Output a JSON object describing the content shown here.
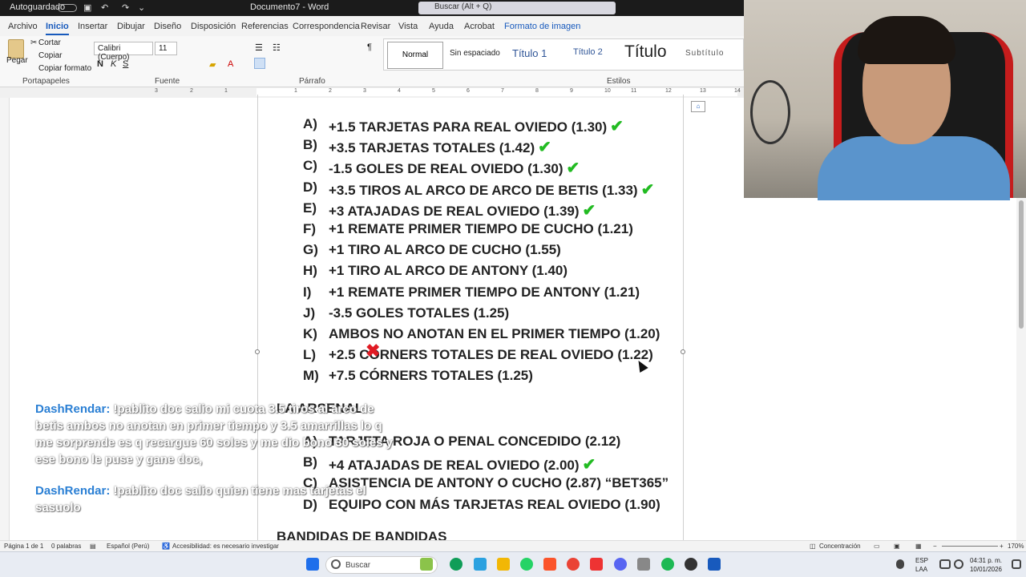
{
  "titlebar": {
    "autosave": "Autoguardado",
    "doc_title": "Documento7 - Word",
    "search": "Buscar (Alt + Q)"
  },
  "tabs": [
    "Archivo",
    "Inicio",
    "Insertar",
    "Dibujar",
    "Diseño",
    "Disposición",
    "Referencias",
    "Correspondencia",
    "Revisar",
    "Vista",
    "Ayuda",
    "Acrobat",
    "Formato de imagen"
  ],
  "ribbon": {
    "clipboard": {
      "paste": "Pegar",
      "cut": "Cortar",
      "copy": "Copiar",
      "format_painter": "Copiar formato",
      "label": "Portapapeles"
    },
    "font": {
      "name": "Calibri (Cuerpo)",
      "size": "11",
      "label": "Fuente",
      "bold": "N",
      "italic": "K",
      "underline": "S"
    },
    "paragraph": {
      "label": "Párrafo"
    },
    "styles": {
      "label": "Estilos",
      "items": [
        "Normal",
        "Sin espaciado",
        "Título 1",
        "Título 2",
        "Título",
        "Subtítulo"
      ]
    }
  },
  "ruler_numbers": [
    "3",
    "2",
    "1",
    "1",
    "2",
    "3",
    "4",
    "5",
    "6",
    "7",
    "8",
    "9",
    "10",
    "11",
    "12",
    "13",
    "14"
  ],
  "picks": [
    {
      "letter": "A)",
      "text": "+1.5 TARJETAS PARA REAL OVIEDO (1.30)",
      "check": true
    },
    {
      "letter": "B)",
      "text": "+3.5 TARJETAS TOTALES (1.42)",
      "check": true
    },
    {
      "letter": "C)",
      "text": "-1.5 GOLES DE REAL OVIEDO (1.30)",
      "check": true
    },
    {
      "letter": "D)",
      "text": "+3.5 TIROS AL ARCO DE ARCO DE BETIS (1.33)",
      "check": true
    },
    {
      "letter": "E)",
      "text": "+3 ATAJADAS DE REAL OVIEDO (1.39)",
      "check": true
    },
    {
      "letter": "F)",
      "text": "+1 REMATE PRIMER TIEMPO DE CUCHO (1.21)",
      "check": false
    },
    {
      "letter": "G)",
      "text": "+1 TIRO AL ARCO DE CUCHO (1.55)",
      "check": false
    },
    {
      "letter": "H)",
      "text": "+1 TIRO AL ARCO DE ANTONY (1.40)",
      "check": false
    },
    {
      "letter": "I)",
      "text": "+1 REMATE PRIMER TIEMPO DE ANTONY (1.21)",
      "check": false
    },
    {
      "letter": "J)",
      "text": "-3.5 GOLES TOTALES (1.25)",
      "check": false
    },
    {
      "letter": "K)",
      "text": "AMBOS NO ANOTAN EN EL PRIMER TIEMPO (1.20)",
      "check": false
    },
    {
      "letter": "L)",
      "text": "+2.5 CÓRNERS TOTALES DE REAL OVIEDO (1.22)",
      "check": false
    },
    {
      "letter": "M)",
      "text": "+7.5 CÓRNERS TOTALES (1.25)",
      "check": false
    }
  ],
  "section2_heading": "LA ARSENAL",
  "picks2": [
    {
      "letter": "A)",
      "text": "TARJETA ROJA O PENAL CONCEDIDO (2.12)",
      "check": false
    },
    {
      "letter": "B)",
      "text": "+4 ATAJADAS DE REAL OVIEDO (2.00)",
      "check": true
    },
    {
      "letter": "C)",
      "text": "ASISTENCIA DE ANTONY O CUCHO (2.87) “BET365”",
      "check": false
    },
    {
      "letter": "D)",
      "text": "EQUIPO CON MÁS TARJETAS REAL OVIEDO (1.90)",
      "check": false
    }
  ],
  "section3_heading": "BANDIDAS DE BANDIDAS",
  "chat": [
    {
      "user": "DashRendar:",
      "lines": [
        " !pablito doc salio mi cuota 3.5 tiros al arco de",
        "betis ambos no anotan en primer tiempo y 3.5 amarrillas lo q",
        "me sorprende es q recargue 60 soles y me dio bono 30 soles y",
        "ese bono le puse y gane doc,"
      ]
    },
    {
      "user": "DashRendar:",
      "lines": [
        " !pablito doc salio quien tiene mas tarjetas el",
        "sasuolo"
      ]
    }
  ],
  "statusbar": {
    "page": "Página 1 de 1",
    "words": "0 palabras",
    "language": "Español (Perú)",
    "accessibility": "Accesibilidad: es necesario investigar",
    "focus": "Concentración",
    "zoom": "170%"
  },
  "taskbar": {
    "search": "Buscar",
    "lang": "ESP",
    "lang2": "LAA",
    "time": "04:31 p. m.",
    "date": "10/01/2026"
  },
  "colors": {
    "accent": "#185abd",
    "check": "#22bb22",
    "xmark": "#e01b24",
    "chat_user": "#2a7fd4"
  }
}
